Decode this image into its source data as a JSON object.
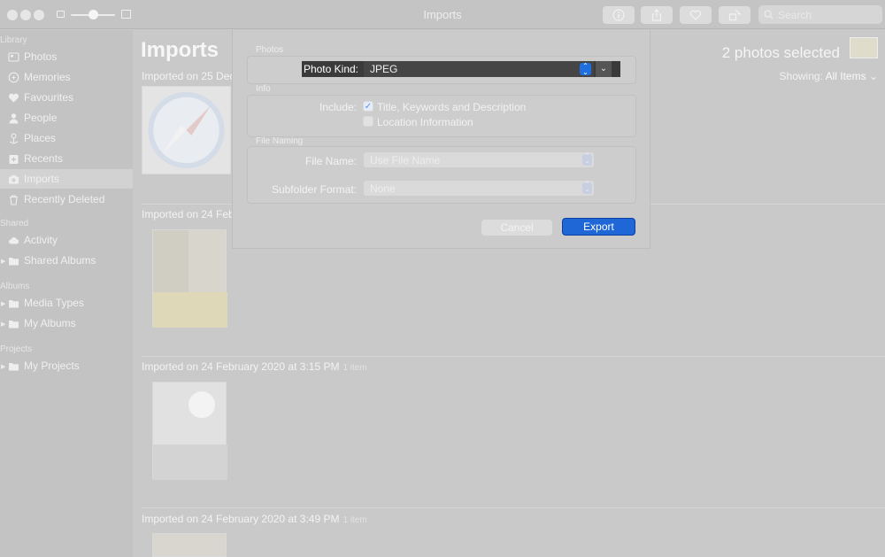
{
  "window": {
    "title": "Imports"
  },
  "toolbar": {
    "search_placeholder": "Search",
    "buttons": [
      "info-icon",
      "share-icon",
      "heart-icon",
      "rotate-icon"
    ]
  },
  "sidebar": {
    "sections": {
      "library": "Library",
      "shared": "Shared",
      "albums": "Albums",
      "projects": "Projects"
    },
    "library_items": [
      {
        "label": "Photos",
        "icon": "photos-icon"
      },
      {
        "label": "Memories",
        "icon": "memories-icon"
      },
      {
        "label": "Favourites",
        "icon": "heart-icon"
      },
      {
        "label": "People",
        "icon": "person-icon"
      },
      {
        "label": "Places",
        "icon": "pin-icon"
      },
      {
        "label": "Recents",
        "icon": "recents-icon"
      },
      {
        "label": "Imports",
        "icon": "camera-icon",
        "selected": true
      },
      {
        "label": "Recently Deleted",
        "icon": "trash-icon"
      }
    ],
    "shared_items": [
      {
        "label": "Activity",
        "icon": "cloud-icon"
      },
      {
        "label": "Shared Albums",
        "icon": "folder-icon"
      }
    ],
    "album_items": [
      {
        "label": "Media Types",
        "icon": "folder-icon"
      },
      {
        "label": "My Albums",
        "icon": "folder-icon"
      }
    ],
    "project_items": [
      {
        "label": "My Projects",
        "icon": "folder-icon"
      }
    ]
  },
  "main": {
    "title": "Imports",
    "selected_count": "2 photos selected",
    "showing_label": "Showing:",
    "showing_value": "All Items",
    "groups": [
      {
        "heading": "Imported on 25 Dec",
        "count": ""
      },
      {
        "heading": "Imported on 24 Feb",
        "count": ""
      },
      {
        "heading": "Imported on 24 February 2020 at 3:15 PM",
        "count": "1 item"
      },
      {
        "heading": "Imported on 24 February 2020 at 3:49 PM",
        "count": "1 item"
      }
    ]
  },
  "dialog": {
    "photos_section": "Photos",
    "photo_kind_label": "Photo Kind:",
    "photo_kind_value": "JPEG",
    "info_section": "Info",
    "include_label": "Include:",
    "include_title_keywords": "Title, Keywords and Description",
    "include_location": "Location Information",
    "title_keywords_checked": true,
    "location_checked": false,
    "file_naming_section": "File Naming",
    "file_name_label": "File Name:",
    "file_name_value": "Use File Name",
    "subfolder_label": "Subfolder Format:",
    "subfolder_value": "None",
    "cancel_label": "Cancel",
    "export_label": "Export"
  },
  "colors": {
    "accent": "#1f66d6",
    "dimmed_background": "#c9c9c9"
  }
}
